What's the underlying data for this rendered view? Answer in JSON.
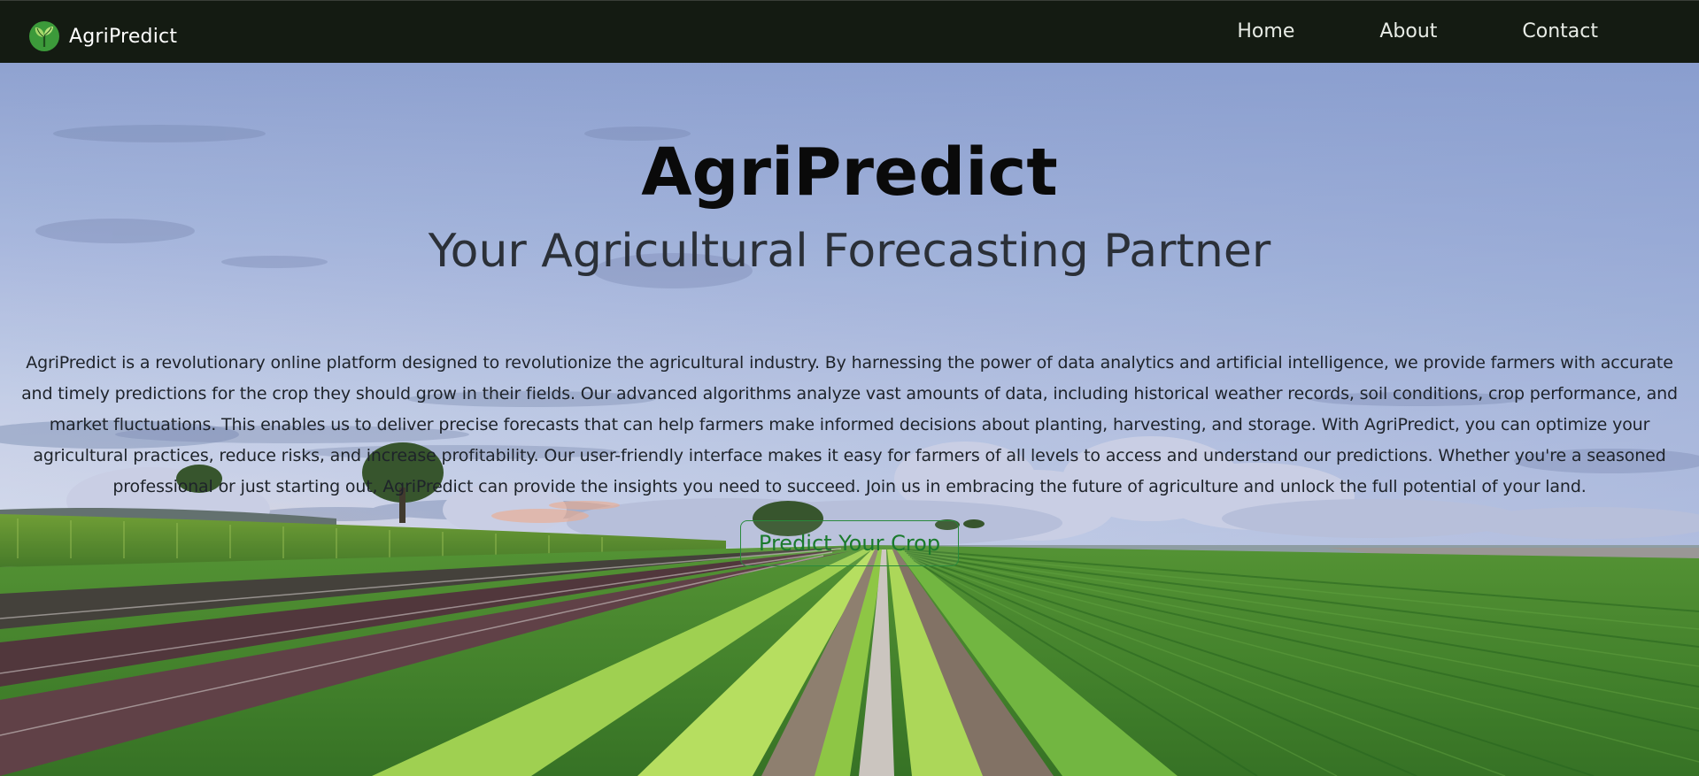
{
  "navbar": {
    "brand": "AgriPredict",
    "logo_icon": "leaf-sprout-icon",
    "links": [
      "Home",
      "About",
      "Contact"
    ],
    "background": "#141b12"
  },
  "hero": {
    "title": "AgriPredict",
    "subtitle": "Your Agricultural Forecasting Partner",
    "description": "AgriPredict is a revolutionary online platform designed to revolutionize the agricultural industry. By harnessing the power of data analytics and artificial intelligence, we provide farmers with accurate and timely predictions for the crop they should grow in their fields. Our advanced algorithms analyze vast amounts of data, including historical weather records, soil conditions, crop performance, and market fluctuations. This enables us to deliver precise forecasts that can help farmers make informed decisions about planting, harvesting, and storage. With AgriPredict, you can optimize your agricultural practices, reduce risks, and increase profitability. Our user-friendly interface makes it easy for farmers of all levels to access and understand our predictions. Whether you're a seasoned professional or just starting out, AgriPredict can provide the insights you need to succeed. Join us in embracing the future of agriculture and unlock the full potential of your land.",
    "cta_label": "Predict Your Crop",
    "accent_color": "#1a7a2c"
  }
}
